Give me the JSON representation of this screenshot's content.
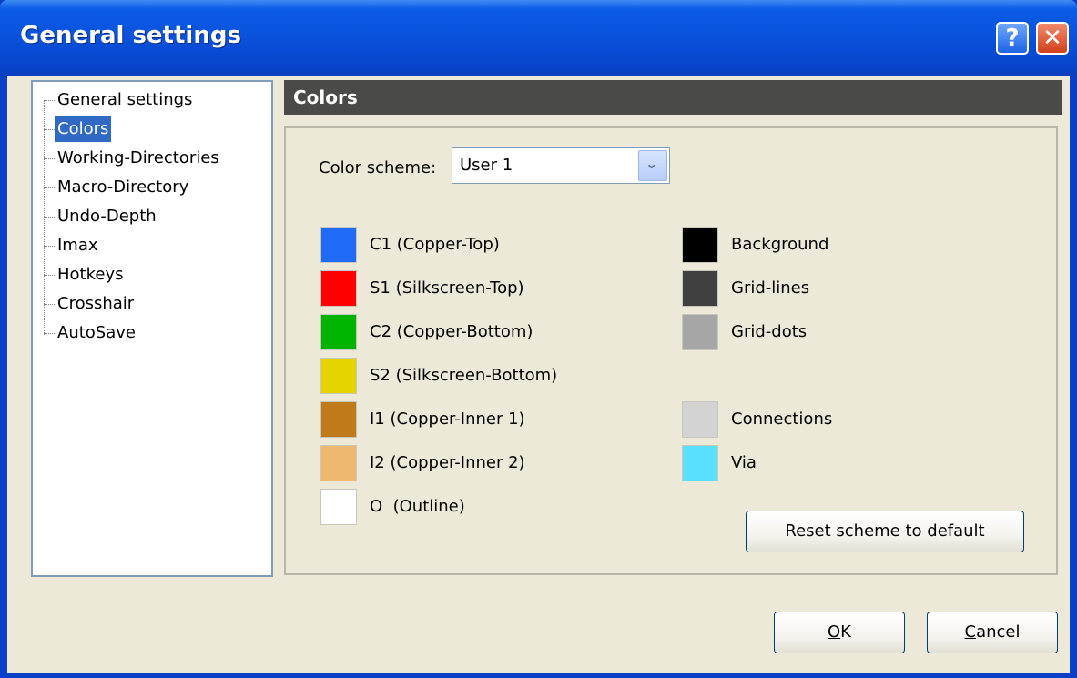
{
  "window": {
    "title": "General settings"
  },
  "tree": {
    "items": [
      {
        "label": "General settings",
        "selected": false
      },
      {
        "label": "Colors",
        "selected": true
      },
      {
        "label": "Working-Directories",
        "selected": false
      },
      {
        "label": "Macro-Directory",
        "selected": false
      },
      {
        "label": "Undo-Depth",
        "selected": false
      },
      {
        "label": "Imax",
        "selected": false
      },
      {
        "label": "Hotkeys",
        "selected": false
      },
      {
        "label": "Crosshair",
        "selected": false
      },
      {
        "label": "AutoSave",
        "selected": false
      }
    ]
  },
  "section": {
    "title": "Colors"
  },
  "color_scheme": {
    "label": "Color scheme:",
    "value": "User 1"
  },
  "layers": [
    {
      "label": "C1 (Copper-Top)",
      "color": "#1f6bf5"
    },
    {
      "label": "S1 (Silkscreen-Top)",
      "color": "#ff0000"
    },
    {
      "label": "C2 (Copper-Bottom)",
      "color": "#00b300"
    },
    {
      "label": "S2 (Silkscreen-Bottom)",
      "color": "#e5d400"
    },
    {
      "label": "I1 (Copper-Inner 1)",
      "color": "#bf7a1a"
    },
    {
      "label": "I2 (Copper-Inner 2)",
      "color": "#efb870"
    },
    {
      "label": "O  (Outline)",
      "color": "#ffffff"
    }
  ],
  "display_colors": [
    {
      "label": "Background",
      "color": "#000000"
    },
    {
      "label": "Grid-lines",
      "color": "#404040"
    },
    {
      "label": "Grid-dots",
      "color": "#a6a6a6"
    },
    {
      "label": "Connections",
      "color": "#d3d3d3"
    },
    {
      "label": "Via",
      "color": "#5ae0ff"
    }
  ],
  "buttons": {
    "reset": "Reset scheme to default",
    "ok_mnemonic": "O",
    "ok_rest": "K",
    "cancel_mnemonic": "C",
    "cancel_rest": "ancel"
  },
  "icons": {
    "help": "?",
    "close": "✕",
    "dropdown": "⌄"
  }
}
